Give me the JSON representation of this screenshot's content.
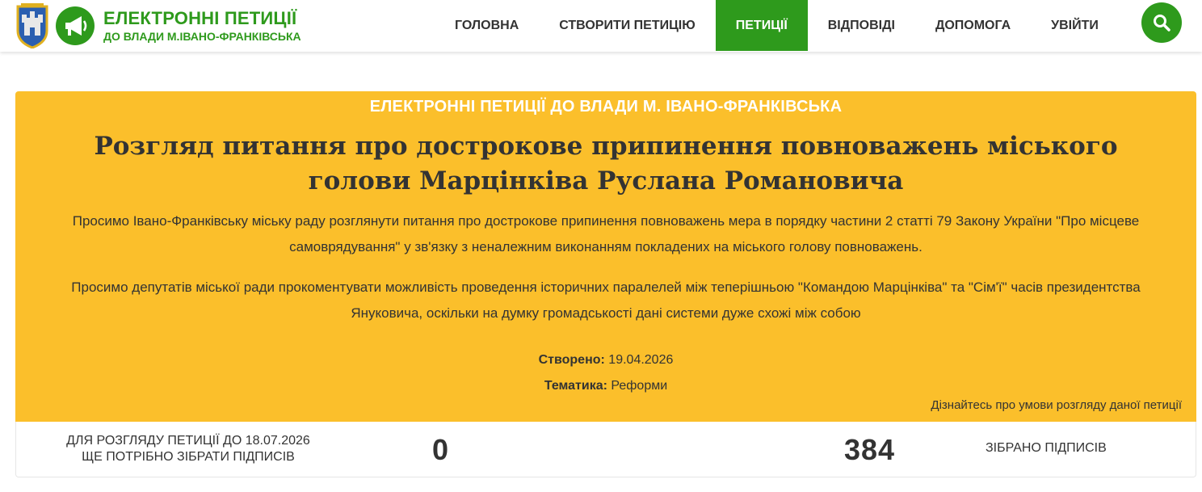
{
  "header": {
    "brand_title": "ЕЛЕКТРОННІ ПЕТИЦІЇ",
    "brand_subtitle": "ДО ВЛАДИ М.ІВАНО-ФРАНКІВСЬКА",
    "nav": [
      {
        "label": "ГОЛОВНА",
        "active": false
      },
      {
        "label": "СТВОРИТИ ПЕТИЦІЮ",
        "active": false
      },
      {
        "label": "ПЕТИЦІЇ",
        "active": true
      },
      {
        "label": "ВІДПОВІДІ",
        "active": false
      },
      {
        "label": "ДОПОМОГА",
        "active": false
      },
      {
        "label": "УВІЙТИ",
        "active": false
      }
    ],
    "search_icon": "search-icon"
  },
  "petition": {
    "caption": "ЕЛЕКТРОННІ ПЕТИЦІЇ ДО ВЛАДИ М. ІВАНО-ФРАНКІВСЬКА",
    "title": "Розгляд питання про дострокове припинення повноважень міського голови Марцінківа Руслана Романовича",
    "paragraphs": [
      "Просимо Івано-Франківську міську раду розглянути питання про дострокове припинення повноважень мера в порядку частини 2 статті 79 Закону України \"Про місцеве самоврядування\" у зв'язку з неналежним виконанням покладених на міського голову повноважень.",
      "Просимо депутатів міської ради прокоментувати можливість проведення історичних паралелей між теперішньою \"Командою Марцінківа\" та \"Сім'ї\" часів президентства Януковича, оскільки на думку громадськості дані системи дуже схожі між собою"
    ],
    "created_label": "Створено:",
    "created_value": "19.04.2026",
    "topic_label": "Тематика:",
    "topic_value": "Реформи",
    "conditions_link": "Дізнайтесь про умови розгляду даної петиції"
  },
  "stats": {
    "deadline_line1": "ДЛЯ РОЗГЛЯДУ ПЕТИЦІЇ ДО 18.07.2026",
    "deadline_line2": "ЩЕ ПОТРІБНО ЗІБРАТИ ПІДПИСІВ",
    "needed": "0",
    "collected": "384",
    "collected_label": "ЗІБРАНО ПІДПИСІВ"
  },
  "colors": {
    "brand_green": "#2e9a1c",
    "panel_yellow": "#fbbf2b",
    "text_dark": "#333333"
  }
}
